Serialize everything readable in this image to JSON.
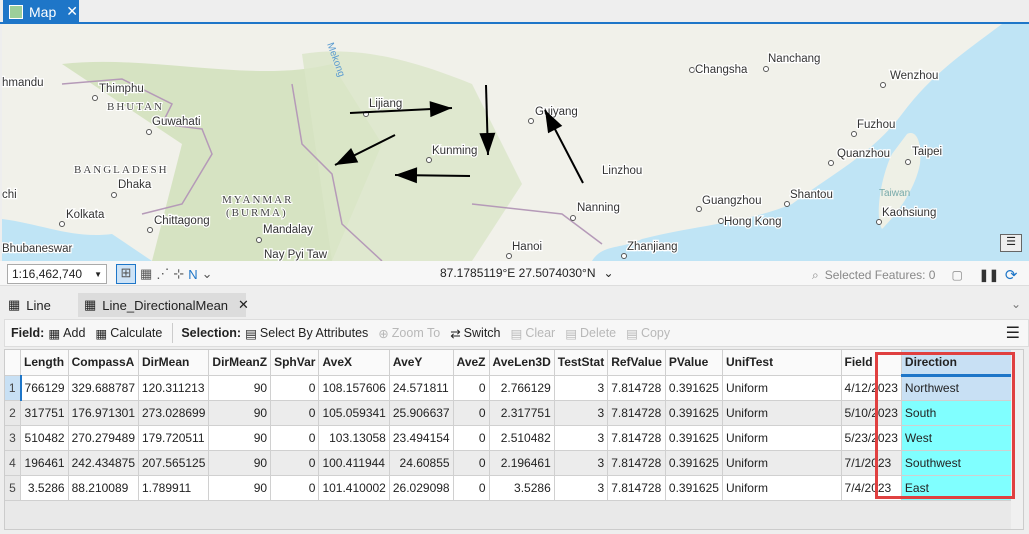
{
  "map_tab": {
    "title": "Map",
    "icon": "map-icon"
  },
  "map": {
    "labels": {
      "hmandu": "hmandu",
      "Thimphu": "Thimphu",
      "BHUTAN": "BHUTAN",
      "Guwahati": "Guwahati",
      "BANGLADESH": "BANGLADESH",
      "Dhaka": "Dhaka",
      "chi": "chi",
      "Kolkata": "Kolkata",
      "Chittagong": "Chittagong",
      "MYANMAR": "MYANMAR",
      "BURMA": "(BURMA)",
      "Mandalay": "Mandalay",
      "Bhubaneswar": "Bhubaneswar",
      "Nay Pyi Taw": "Nay Pyi Taw",
      "Mekong": "Mekong",
      "Lijiang": "Lijiang",
      "Kunming": "Kunming",
      "Guiyang": "Guiyang",
      "Linzhou": "Linzhou",
      "Nanning": "Nanning",
      "Hanoi": "Hanoi",
      "Zhanjiang": "Zhanjiang",
      "Guangzhou": "Guangzhou",
      "Hong Kong": "Hong Kong",
      "Shantou": "Shantou",
      "Changsha": "Changsha",
      "Nanchang": "Nanchang",
      "Wenzhou": "Wenzhou",
      "Fuzhou": "Fuzhou",
      "Quanzhou": "Quanzhou",
      "Taipei": "Taipei",
      "Taiwan": "Taiwan",
      "Kaohsiung": "Kaohsiung"
    }
  },
  "status": {
    "scale": "1:16,462,740",
    "coords": "87.1785119°E 27.5074030°N",
    "selected": "Selected Features: 0"
  },
  "table_tabs": [
    {
      "label": "Line"
    },
    {
      "label": "Line_DirectionalMean"
    }
  ],
  "toolbar": {
    "field_label": "Field:",
    "add": "Add",
    "calculate": "Calculate",
    "selection_label": "Selection:",
    "select_by_attributes": "Select By Attributes",
    "zoom_to": "Zoom To",
    "switch": "Switch",
    "clear": "Clear",
    "delete": "Delete",
    "copy": "Copy"
  },
  "table": {
    "columns": [
      "Length",
      "CompassA",
      "DirMean",
      "DirMeanZ",
      "SphVar",
      "AveX",
      "AveY",
      "AveZ",
      "AveLen3D",
      "TestStat",
      "RefValue",
      "PValue",
      "UnifTest",
      "Field",
      "Direction"
    ],
    "rows": [
      [
        "1",
        "766129",
        "329.688787",
        "120.311213",
        "90",
        "0",
        "108.157606",
        "24.571811",
        "0",
        "2.766129",
        "3",
        "7.814728",
        "0.391625",
        "Uniform",
        "4/12/2023",
        "Northwest"
      ],
      [
        "2",
        "317751",
        "176.971301",
        "273.028699",
        "90",
        "0",
        "105.059341",
        "25.906637",
        "0",
        "2.317751",
        "3",
        "7.814728",
        "0.391625",
        "Uniform",
        "5/10/2023",
        "South"
      ],
      [
        "3",
        "510482",
        "270.279489",
        "179.720511",
        "90",
        "0",
        "103.13058",
        "23.494154",
        "0",
        "2.510482",
        "3",
        "7.814728",
        "0.391625",
        "Uniform",
        "5/23/2023",
        "West"
      ],
      [
        "4",
        "196461",
        "242.434875",
        "207.565125",
        "90",
        "0",
        "100.411944",
        "24.60855",
        "0",
        "2.196461",
        "3",
        "7.814728",
        "0.391625",
        "Uniform",
        "7/1/2023",
        "Southwest"
      ],
      [
        "5",
        "3.5286",
        "88.210089",
        "1.789911",
        "90",
        "0",
        "101.410002",
        "26.029098",
        "0",
        "3.5286",
        "3",
        "7.814728",
        "0.391625",
        "Uniform",
        "7/4/2023",
        "East"
      ]
    ]
  },
  "colors": {
    "accent": "#1e76c8",
    "highlight": "#80ffff",
    "selected_row": "#c8e0f4",
    "annotation_box": "#e04040"
  }
}
